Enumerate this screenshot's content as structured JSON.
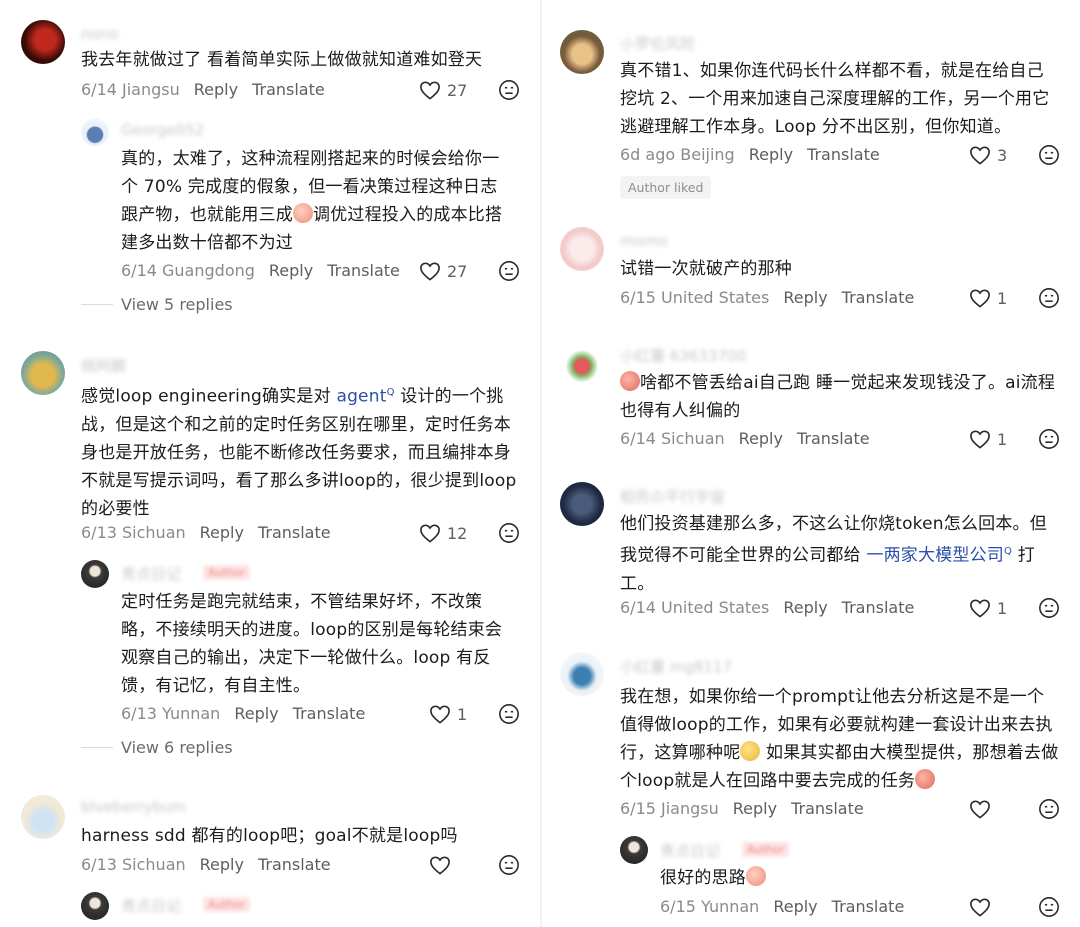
{
  "icons": {
    "like": "heart-outline-icon",
    "dislike": "dislike-face-icon",
    "search": "search-superscript-icon"
  },
  "actions": {
    "reply": "Reply",
    "translate": "Translate"
  },
  "left": [
    {
      "id": "c1",
      "username": "nono",
      "text": "我去年就做过了  看着简单实际上做做就知道难如登天",
      "meta": "6/14 Jiangsu",
      "likes": "27"
    },
    {
      "id": "c1r1",
      "username": "George052",
      "text_parts": [
        "真的，太难了，这种流程刚搭起来的时候会给你一个 70% 完成度的假象，但一看决策过程这种日志跟产物，也就能用三成",
        "调优过程投入的成本比搭建多出数十倍都不为过"
      ],
      "meta": "6/14 Guangdong",
      "likes": "27"
    },
    {
      "id": "c1vr",
      "view_replies": "View 5 replies"
    },
    {
      "id": "c2",
      "username": "桃阿麟",
      "text_parts": [
        "感觉loop engineering确实是对 ",
        "agent",
        " 设计的一个挑战，但是这个和之前的定时任务区别在哪里，定时任务本身也是开放任务，也能不断修改任务要求，而且编排本身不就是写提示词吗，看了那么多讲loop的，很少提到loop的必要性"
      ],
      "meta": "6/13 Sichuan",
      "likes": "12"
    },
    {
      "id": "c2r1",
      "username": "青点日记",
      "badge": "Author",
      "text": "定时任务是跑完就结束，不管结果好坏，不改策略，不接续明天的进度。loop的区别是每轮结束会观察自己的输出，决定下一轮做什么。loop 有反馈，有记忆，有自主性。",
      "meta": "6/13 Yunnan",
      "likes": "1"
    },
    {
      "id": "c2vr",
      "view_replies": "View 6 replies"
    },
    {
      "id": "c3",
      "username": "blveberrybum",
      "text": "harness sdd 都有的loop吧；goal不就是loop吗",
      "meta": "6/13 Sichuan",
      "likes": ""
    },
    {
      "id": "c3r1",
      "username": "青点日记",
      "badge": "Author"
    }
  ],
  "right": [
    {
      "id": "c4",
      "username": "小罗伦风险",
      "text": "真不错1、如果你连代码长什么样都不看，就是在给自己挖坑 2、一个用来加速自己深度理解的工作，另一个用它逃避理解工作本身。Loop 分不出区别，但你知道。",
      "meta": "6d ago Beijing",
      "likes": "3",
      "author_liked": "Author liked"
    },
    {
      "id": "c5",
      "username": "momo",
      "text": "试错一次就破产的那种",
      "meta": "6/15 United States",
      "likes": "1"
    },
    {
      "id": "c6",
      "username": "小红薯 63633700",
      "text_parts": [
        "",
        "啥都不管丢给ai自己跑 睡一觉起来发现钱没了。ai流程也得有人纠偏的"
      ],
      "meta": "6/14 Sichuan",
      "likes": "1"
    },
    {
      "id": "c7",
      "username": "稻壳の平行宇宙",
      "text_parts": [
        "他们投资基建那么多，不这么让你烧token怎么回本。但我觉得不可能全世界的公司都给 ",
        "一两家大模型公司",
        " 打工。"
      ],
      "meta": "6/14 United States",
      "likes": "1"
    },
    {
      "id": "c8",
      "username": "小红薯 mg8117",
      "text_parts": [
        "我在想，如果你给一个prompt让他去分析这是不是一个值得做loop的工作，如果有必要就构建一套设计出来去执行，这算哪种呢",
        " 如果其实都由大模型提供，那想着去做个loop就是人在回路中要去完成的任务",
        ""
      ],
      "meta": "6/15 Jiangsu",
      "likes": ""
    },
    {
      "id": "c8r1",
      "username": "青点日记",
      "badge": "Author",
      "text_parts": [
        "很好的思路",
        ""
      ],
      "meta": "6/15 Yunnan",
      "likes": ""
    }
  ]
}
